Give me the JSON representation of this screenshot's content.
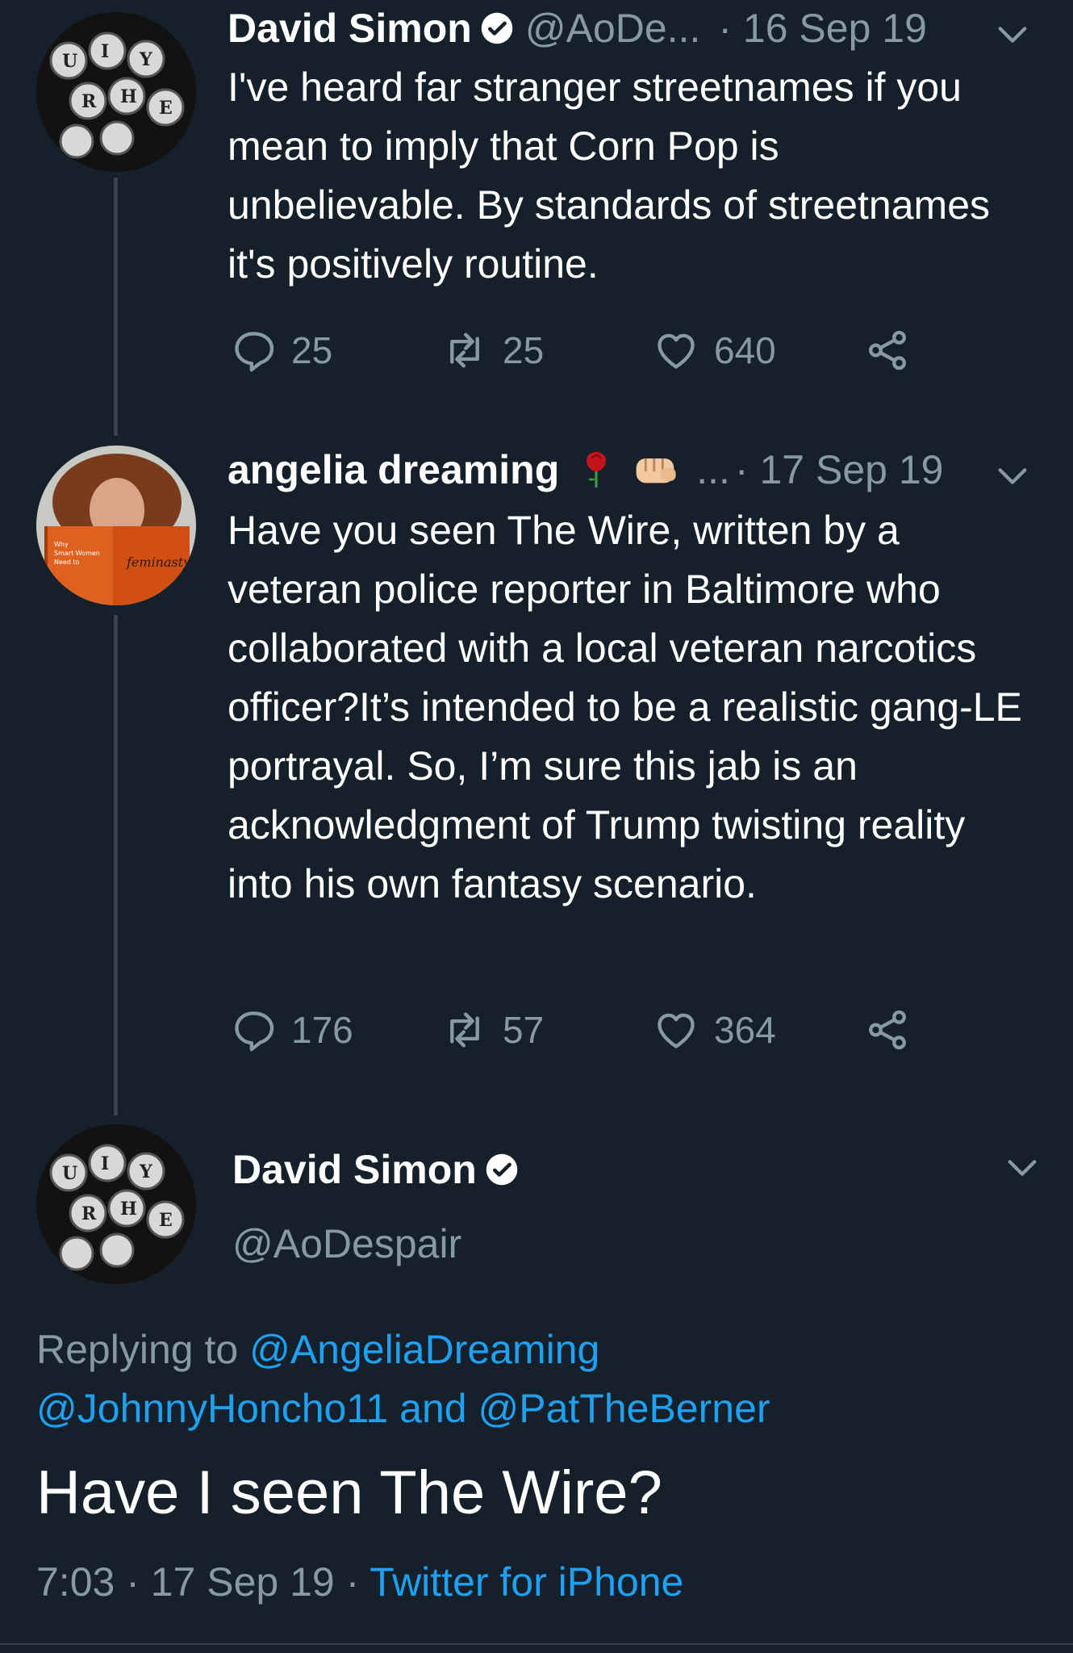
{
  "tweets": [
    {
      "name": "David Simon",
      "handle": "@AoDe...",
      "date": "· 16 Sep 19",
      "text": "I've heard far stranger streetnames if you mean to imply that Corn Pop is unbelievable. By standards of streetnames it's positively routine.",
      "replies": "25",
      "retweets": "25",
      "likes": "640"
    },
    {
      "name": "angelia dreaming",
      "handle": "...",
      "date": "· 17 Sep 19",
      "text": "Have you seen The Wire, written by a veteran police reporter in Baltimore who collaborated with a local veteran narcotics officer?It’s intended to be a realistic gang-LE portrayal. So, I’m sure this jab is an acknowledgment of Trump twisting reality into his own fantasy scenario.",
      "replies": "176",
      "retweets": "57",
      "likes": "364"
    }
  ],
  "main_tweet": {
    "name": "David Simon",
    "handle": "@AoDespair",
    "replying_prefix": "Replying to",
    "reply_user_1": "@AngeliaDreaming",
    "reply_user_2": "@JohnnyHoncho11",
    "reply_and": "and",
    "reply_user_3": "@PatTheBerner",
    "text": "Have I seen The Wire?",
    "time": "7:03 · 17 Sep 19 ·",
    "source": "Twitter for iPhone"
  },
  "colors": {
    "background": "#15202b",
    "muted": "#8899a6",
    "link": "#1da1f2",
    "thread_line": "#38444d"
  },
  "icons": [
    "verified-icon",
    "reply-icon",
    "retweet-icon",
    "like-icon",
    "share-icon",
    "chevron-down-icon",
    "rose-emoji",
    "fist-emoji"
  ]
}
